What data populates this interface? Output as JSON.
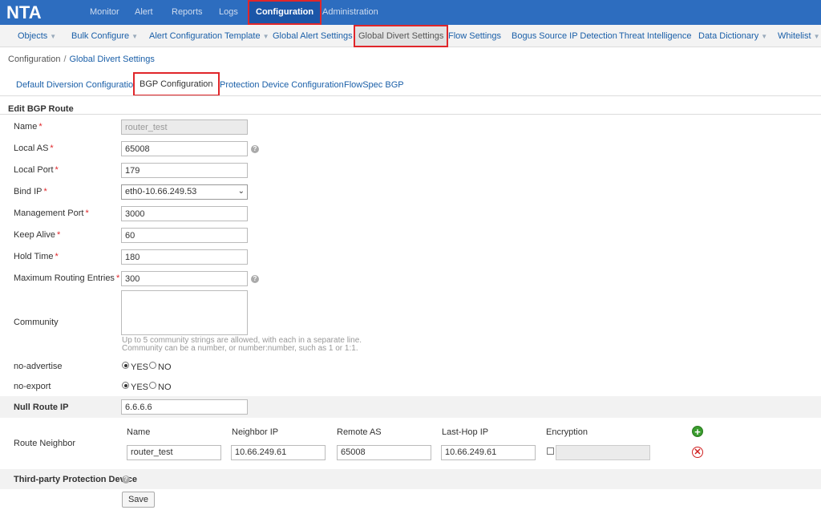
{
  "app": {
    "logo": "NTA"
  },
  "topnav": [
    "Monitor",
    "Alert",
    "Reports",
    "Logs",
    "Configuration",
    "Administration"
  ],
  "subnav": [
    "Objects",
    "Bulk Configure",
    "Alert Configuration Template",
    "Global Alert Settings",
    "Global Divert Settings",
    "Flow Settings",
    "Bogus Source IP Detection",
    "Threat Intelligence",
    "Data Dictionary",
    "Whitelist"
  ],
  "breadcrumb": {
    "root": "Configuration",
    "sep": "/",
    "current": "Global Divert Settings"
  },
  "tabs": [
    "Default Diversion Configuration",
    "BGP Configuration",
    "Protection Device Configuration",
    "FlowSpec BGP"
  ],
  "form": {
    "section_title": "Edit BGP Route",
    "name": {
      "label": "Name",
      "req": "*",
      "value": "router_test"
    },
    "local_as": {
      "label": "Local AS",
      "req": "*",
      "value": "65008"
    },
    "local_port": {
      "label": "Local Port",
      "req": "*",
      "value": "179"
    },
    "bind_ip": {
      "label": "Bind IP",
      "req": "*",
      "value": "eth0-10.66.249.53"
    },
    "mgmt_port": {
      "label": "Management Port",
      "req": "*",
      "value": "3000"
    },
    "keep_alive": {
      "label": "Keep Alive",
      "req": "*",
      "value": "60"
    },
    "hold_time": {
      "label": "Hold Time",
      "req": "*",
      "value": "180"
    },
    "max_routes": {
      "label": "Maximum Routing Entries",
      "req": "*",
      "value": "300"
    },
    "community": {
      "label": "Community",
      "hint1": "Up to 5 community strings are allowed, with each in a separate line.",
      "hint2": "Community can be a number, or number:number, such as 1 or 1:1."
    },
    "no_advertise": {
      "label": "no-advertise",
      "yes": "YES",
      "no": "NO",
      "selected": "YES"
    },
    "no_export": {
      "label": "no-export",
      "yes": "YES",
      "no": "NO",
      "selected": "YES"
    },
    "null_route": {
      "label": "Null Route IP",
      "value": "6.6.6.6"
    },
    "route_neighbor": {
      "label": "Route Neighbor",
      "columns": [
        "Name",
        "Neighbor IP",
        "Remote AS",
        "Last-Hop IP",
        "Encryption"
      ],
      "row": {
        "name": "router_test",
        "neighbor_ip": "10.66.249.61",
        "remote_as": "65008",
        "last_hop_ip": "10.66.249.61",
        "encryption_checked": false
      }
    },
    "third_party": {
      "label": "Third-party Protection Device"
    },
    "save_label": "Save"
  },
  "icons": {
    "help": "question-circle-icon",
    "add": "plus-circle-icon",
    "delete": "times-circle-icon"
  },
  "colors": {
    "topbar": "#2d6dbf",
    "active_top": "#1b56a8",
    "highlight": "#e0262a",
    "link": "#1a5fa8"
  }
}
